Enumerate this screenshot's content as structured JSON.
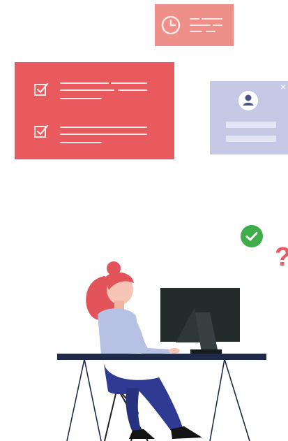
{
  "illustration": {
    "question_mark": "?",
    "close_glyph": "×",
    "colors": {
      "coral": "#e95a5e",
      "light_coral": "#ef8f89",
      "lavender": "#c5c9e6",
      "green": "#3fae4a",
      "navy": "#1f2a49",
      "indigo": "#2f3b92",
      "shirt": "#b7c1e4",
      "hair": "#e2545a",
      "skin": "#f7c5b5",
      "monitor": "#232b2b"
    },
    "icons": [
      "clock-icon",
      "checkbox-checked-icon",
      "user-avatar-icon",
      "close-icon",
      "checkmark-icon",
      "question-mark-icon"
    ]
  }
}
